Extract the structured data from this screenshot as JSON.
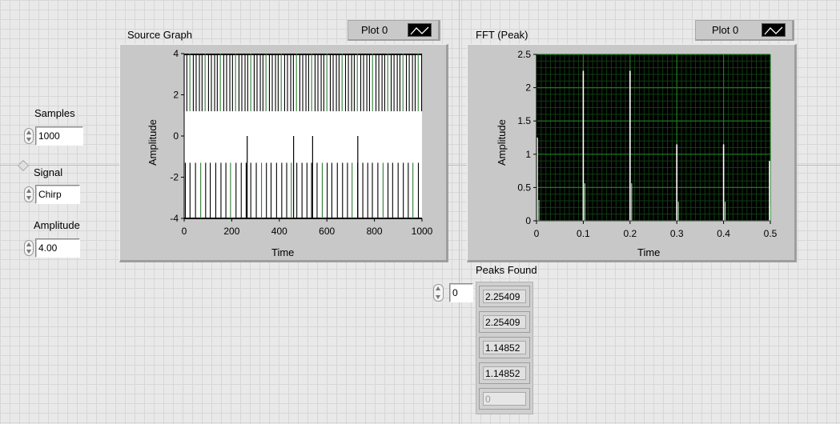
{
  "controls": {
    "samples": {
      "label": "Samples",
      "value": "1000"
    },
    "signal": {
      "label": "Signal",
      "value": "Chirp"
    },
    "amplitude": {
      "label": "Amplitude",
      "value": "4.00"
    }
  },
  "source_graph": {
    "title": "Source Graph",
    "legend_label": "Plot 0",
    "xlabel": "Time",
    "ylabel": "Amplitude",
    "xticks": [
      "0",
      "200",
      "400",
      "600",
      "800",
      "1000"
    ],
    "yticks": [
      "4",
      "2",
      "0",
      "-2",
      "-4"
    ]
  },
  "fft_graph": {
    "title": "FFT (Peak)",
    "legend_label": "Plot 0",
    "xlabel": "Time",
    "ylabel": "Amplitude",
    "xticks": [
      "0",
      "0.1",
      "0.2",
      "0.3",
      "0.4",
      "0.5"
    ],
    "yticks": [
      "2.5",
      "2",
      "1.5",
      "1",
      "0.5",
      "0"
    ]
  },
  "peaks": {
    "label": "Peaks Found",
    "index": "0",
    "values": [
      "2.25409",
      "2.25409",
      "1.14852",
      "1.14852",
      "0"
    ]
  },
  "colors": {
    "plot_bg_dark": "#000000",
    "fft_grid": "#1f7a1f",
    "source_plot_bg": "#ffffff",
    "source_trace": "#000000",
    "fft_trace": "#ffffff"
  },
  "chart_data": [
    {
      "type": "line",
      "title": "Source Graph",
      "xlabel": "Time",
      "ylabel": "Amplitude",
      "xlim": [
        0,
        1000
      ],
      "ylim": [
        -4,
        4
      ],
      "grid": false,
      "series": [
        {
          "name": "Plot 0",
          "description_values": "square-wave chirp alternating between +4 and -4",
          "x": [
            0,
            1000
          ],
          "y_high": 4,
          "y_low": -4
        }
      ]
    },
    {
      "type": "line",
      "title": "FFT (Peak)",
      "xlabel": "Time",
      "ylabel": "Amplitude",
      "xlim": [
        0,
        0.5
      ],
      "ylim": [
        0,
        2.5
      ],
      "grid": true,
      "series": [
        {
          "name": "Plot 0",
          "x": [
            0,
            0.1,
            0.2,
            0.3,
            0.4,
            0.5
          ],
          "y": [
            1.25,
            2.25409,
            2.25409,
            1.14852,
            1.14852,
            0.9
          ]
        }
      ]
    }
  ]
}
